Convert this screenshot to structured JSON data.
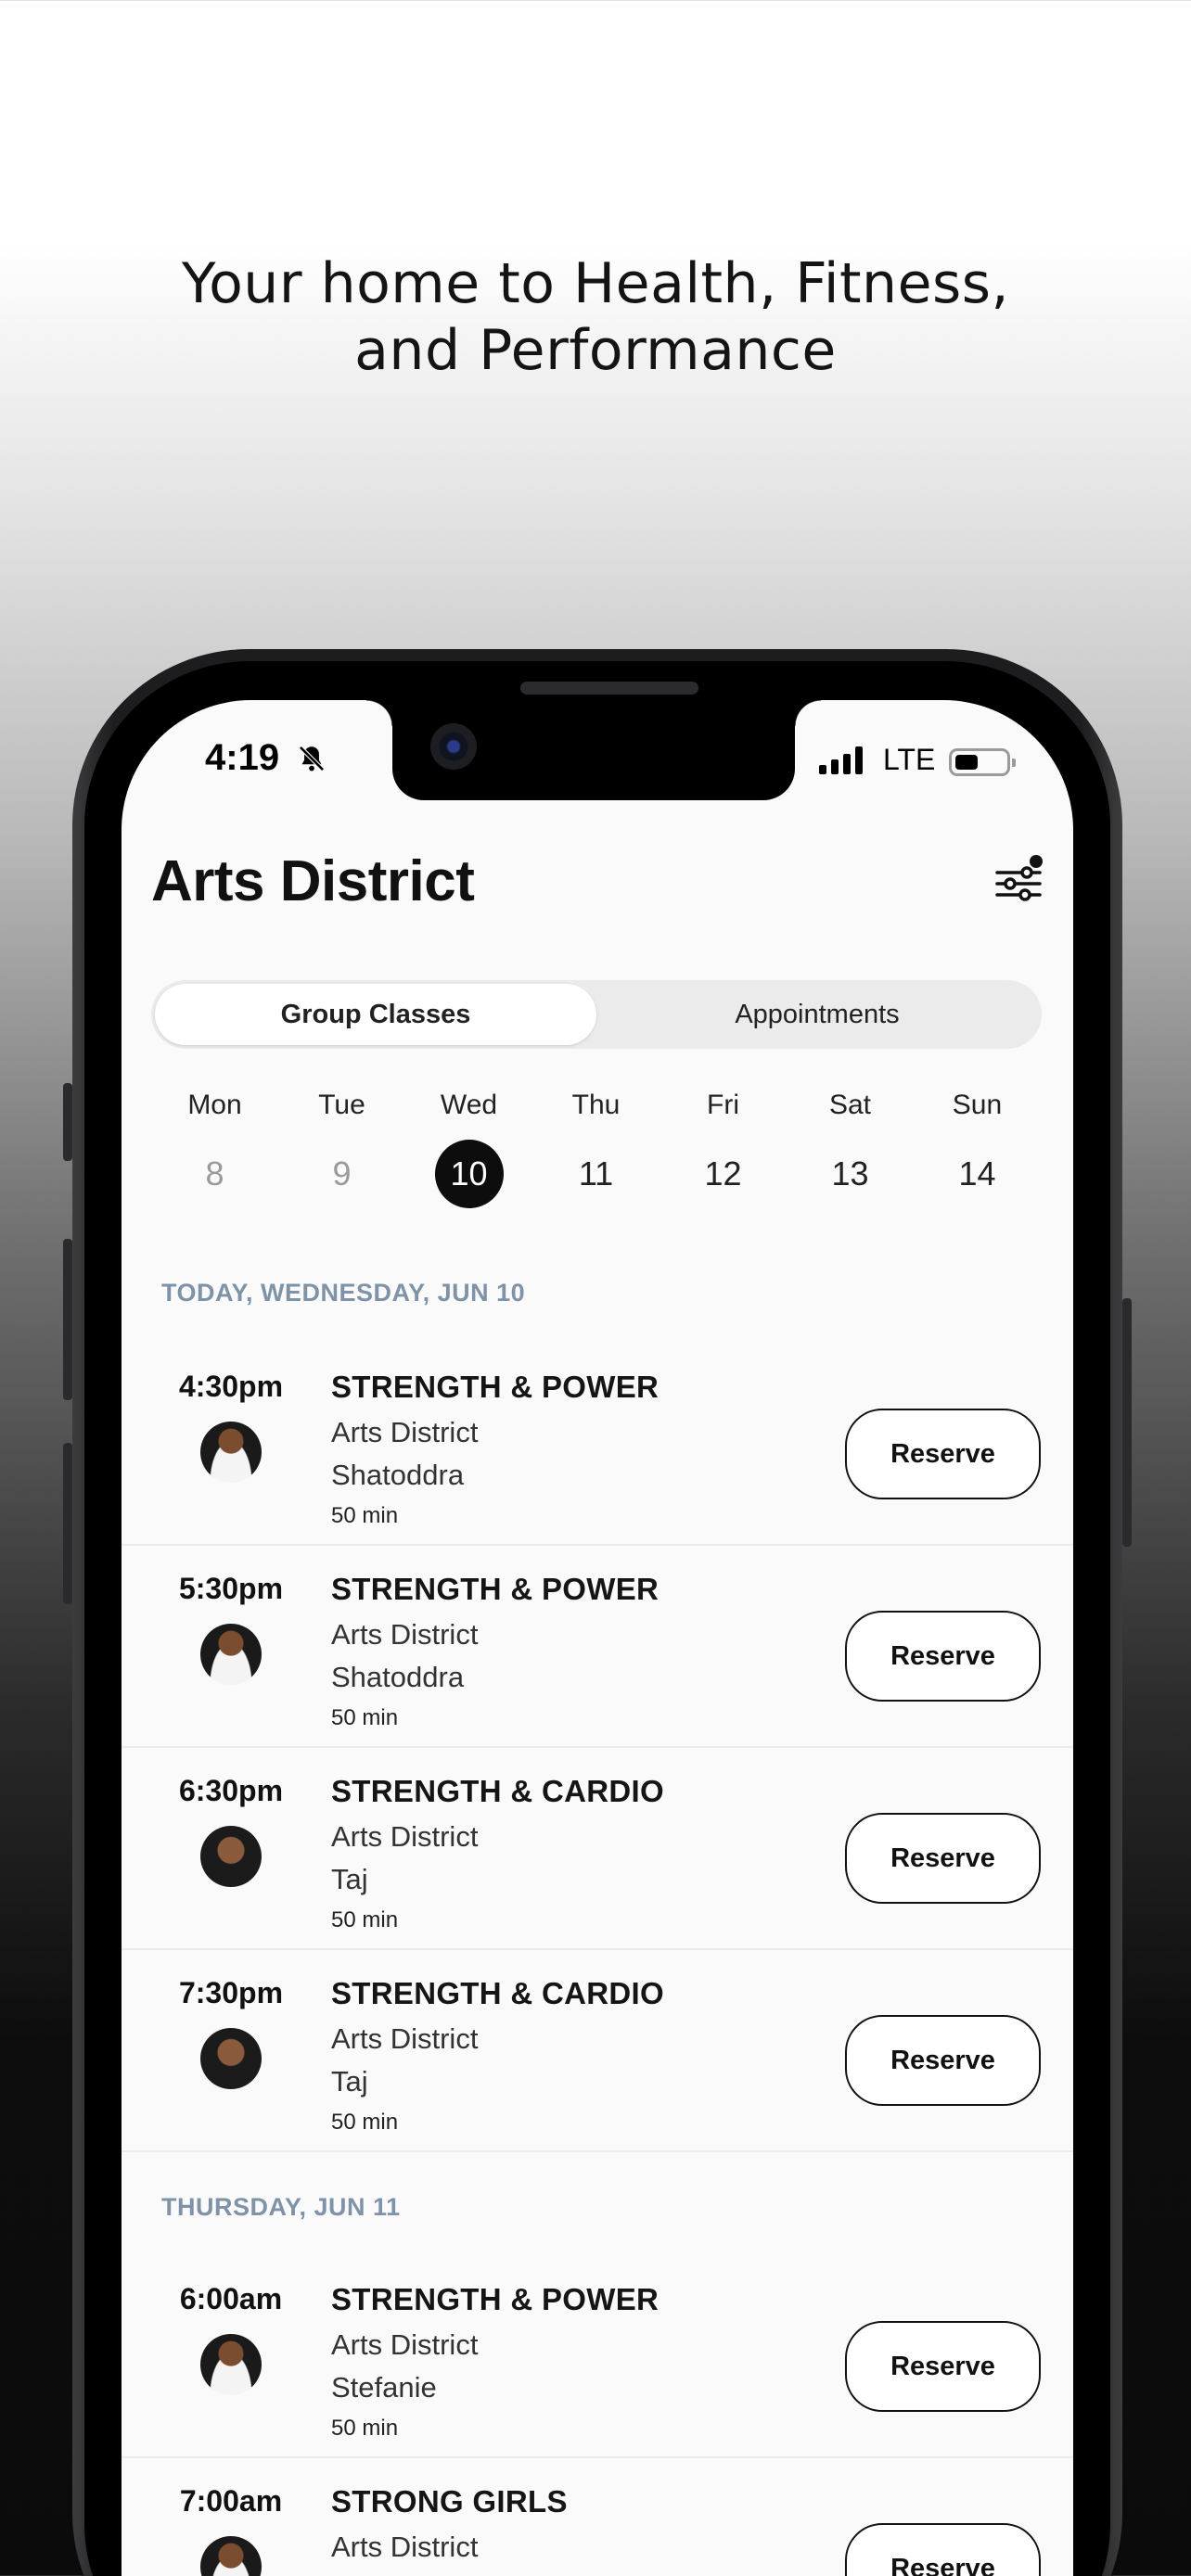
{
  "headline": {
    "line1": "Your home to Health, Fitness,",
    "line2": "and Performance"
  },
  "status_bar": {
    "time": "4:19",
    "network": "LTE",
    "icons": [
      "bell-slash-icon",
      "signal-icon",
      "battery-icon"
    ]
  },
  "header": {
    "title": "Arts District",
    "filter_icon": "sliders-icon"
  },
  "tabs": {
    "group_classes": "Group Classes",
    "appointments": "Appointments",
    "active": "Group Classes"
  },
  "week": [
    {
      "name": "Mon",
      "num": "8",
      "state": "past"
    },
    {
      "name": "Tue",
      "num": "9",
      "state": "past"
    },
    {
      "name": "Wed",
      "num": "10",
      "state": "selected"
    },
    {
      "name": "Thu",
      "num": "11",
      "state": "future"
    },
    {
      "name": "Fri",
      "num": "12",
      "state": "future"
    },
    {
      "name": "Sat",
      "num": "13",
      "state": "future"
    },
    {
      "name": "Sun",
      "num": "14",
      "state": "future"
    }
  ],
  "sections": [
    {
      "header": "TODAY, WEDNESDAY, JUN 10",
      "classes": [
        {
          "time": "4:30pm",
          "title": "STRENGTH & POWER",
          "location": "Arts District",
          "coach": "Shatoddra",
          "duration": "50 min",
          "action": "Reserve"
        },
        {
          "time": "5:30pm",
          "title": "STRENGTH & POWER",
          "location": "Arts District",
          "coach": "Shatoddra",
          "duration": "50 min",
          "action": "Reserve"
        },
        {
          "time": "6:30pm",
          "title": "STRENGTH & CARDIO",
          "location": "Arts District",
          "coach": "Taj",
          "duration": "50 min",
          "action": "Reserve"
        },
        {
          "time": "7:30pm",
          "title": "STRENGTH & CARDIO",
          "location": "Arts District",
          "coach": "Taj",
          "duration": "50 min",
          "action": "Reserve"
        }
      ]
    },
    {
      "header": "THURSDAY, JUN 11",
      "classes": [
        {
          "time": "6:00am",
          "title": "STRENGTH & POWER",
          "location": "Arts District",
          "coach": "Stefanie",
          "duration": "50 min",
          "action": "Reserve"
        },
        {
          "time": "7:00am",
          "title": "STRONG GIRLS",
          "location": "Arts District",
          "action": "Reserve"
        }
      ]
    }
  ],
  "colors": {
    "section_header": "#7f93a8",
    "selected_day": "#0d0d0d",
    "screen_bg": "#fafafa"
  }
}
